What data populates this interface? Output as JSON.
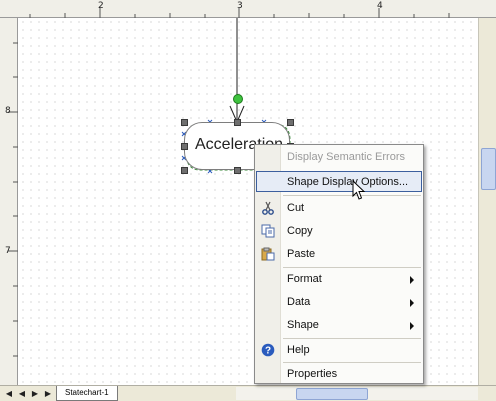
{
  "ruler": {
    "top_numbers": [
      "2",
      "3",
      "4"
    ],
    "left_numbers": [
      "8",
      "7"
    ]
  },
  "diagram": {
    "state_label": "Acceleration"
  },
  "page_tabs": [
    {
      "label": "Statechart-1"
    }
  ],
  "context_menu": {
    "items": [
      {
        "label": "Display Semantic Errors",
        "enabled": false
      },
      {
        "label": "Shape Display Options...",
        "highlighted": true
      },
      {
        "label": "Cut",
        "icon": "scissors-icon"
      },
      {
        "label": "Copy",
        "icon": "copy-icon"
      },
      {
        "label": "Paste",
        "icon": "paste-icon"
      },
      {
        "label": "Format",
        "submenu": true
      },
      {
        "label": "Data",
        "submenu": true
      },
      {
        "label": "Shape",
        "submenu": true
      },
      {
        "label": "Help",
        "icon": "help-icon"
      },
      {
        "label": "Properties"
      }
    ]
  },
  "colors": {
    "selection_handle": "#6f6f6f",
    "rotation_handle": "#3ec23e",
    "menu_highlight_border": "#3c5f9e",
    "help_icon": "#2a5bbd"
  }
}
